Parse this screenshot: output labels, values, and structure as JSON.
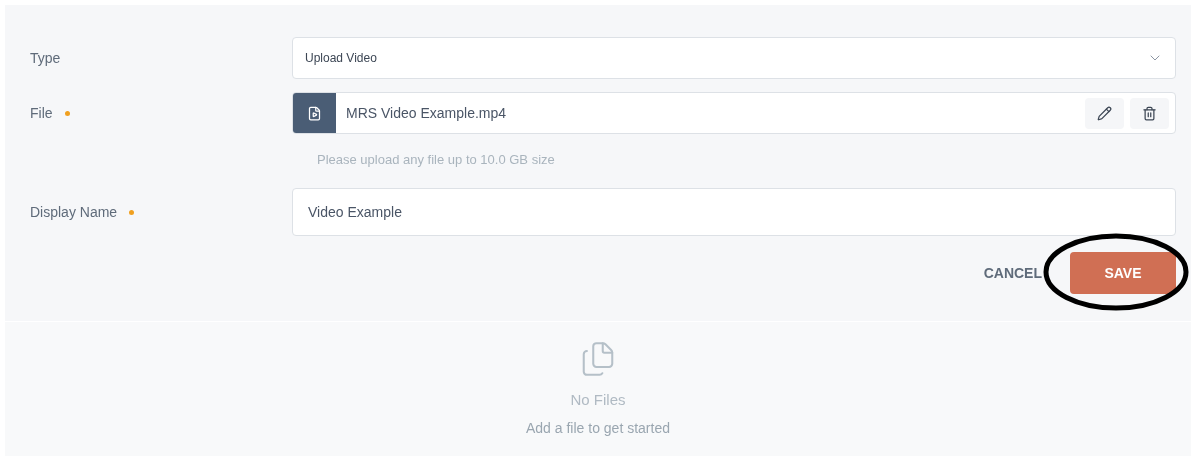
{
  "form": {
    "fields": [
      {
        "kind": "select",
        "label": "Type",
        "required": false,
        "value": "Upload Video"
      },
      {
        "kind": "file",
        "label": "File",
        "required": true,
        "value": "MRS Video Example.mp4",
        "hint": "Please upload any file up to 10.0 GB size"
      },
      {
        "kind": "text",
        "label": "Display Name",
        "required": true,
        "value": "Video Example"
      }
    ],
    "buttons": [
      {
        "kind": "text",
        "label": "CANCEL",
        "highlighted": false
      },
      {
        "kind": "primary",
        "label": "SAVE",
        "highlighted": true
      }
    ]
  },
  "empty_state": {
    "title": "No Files",
    "subtitle": "Add a file to get started"
  }
}
